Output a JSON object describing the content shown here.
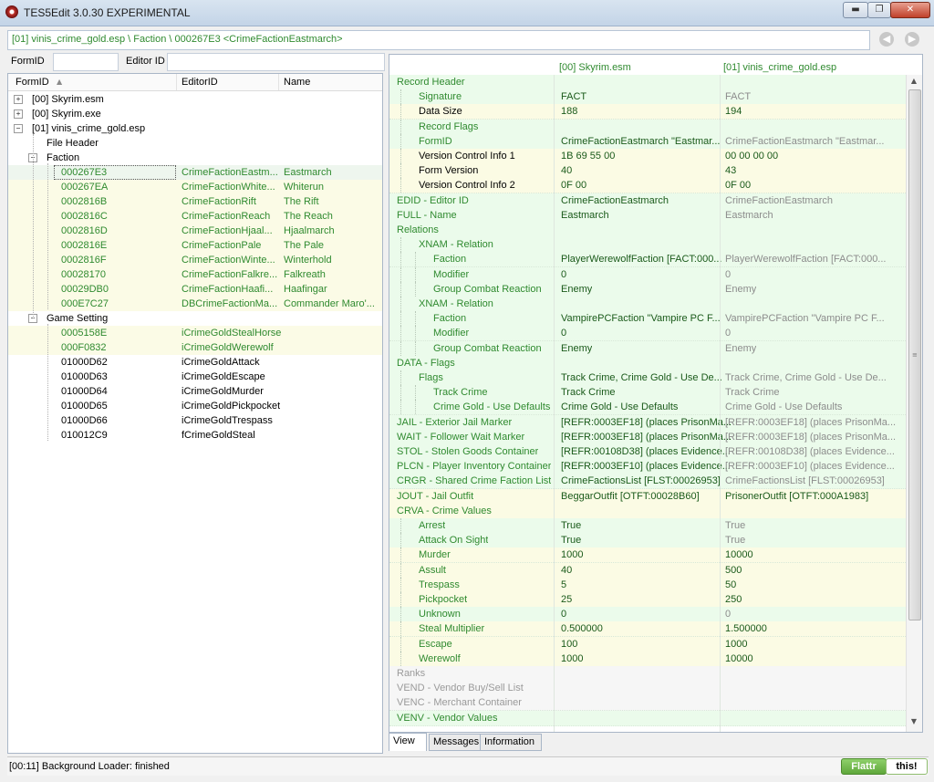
{
  "window": {
    "title": "TES5Edit 3.0.30 EXPERIMENTAL",
    "min_glyph": "▬",
    "max_glyph": "❐",
    "close_glyph": "✕"
  },
  "icons": {
    "back": "arrow-left-icon",
    "forward": "arrow-right-icon",
    "back_glyph": "◀",
    "forward_glyph": "▶",
    "sort_glyph": "▲",
    "expand_glyph": "+",
    "collapse_glyph": "−"
  },
  "path": "[01] vinis_crime_gold.esp \\ Faction \\ 000267E3 <CrimeFactionEastmarch>",
  "filter": {
    "formid_label": "FormID",
    "editorid_label": "Editor ID",
    "formid_value": "",
    "editorid_value": ""
  },
  "tree": {
    "columns": {
      "formid": "FormID",
      "editorid": "EditorID",
      "name": "Name"
    },
    "roots": [
      {
        "label": "[00] Skyrim.esm"
      },
      {
        "label": "[00] Skyrim.exe"
      },
      {
        "label": "[01] vinis_crime_gold.esp"
      }
    ],
    "file_header": "File Header",
    "faction_group": "Faction",
    "faction_rows": [
      {
        "formid": "000267E3",
        "editorid": "CrimeFactionEastm...",
        "name": "Eastmarch"
      },
      {
        "formid": "000267EA",
        "editorid": "CrimeFactionWhite...",
        "name": "Whiterun"
      },
      {
        "formid": "0002816B",
        "editorid": "CrimeFactionRift",
        "name": "The Rift"
      },
      {
        "formid": "0002816C",
        "editorid": "CrimeFactionReach",
        "name": "The Reach"
      },
      {
        "formid": "0002816D",
        "editorid": "CrimeFactionHjaal...",
        "name": "Hjaalmarch"
      },
      {
        "formid": "0002816E",
        "editorid": "CrimeFactionPale",
        "name": "The Pale"
      },
      {
        "formid": "0002816F",
        "editorid": "CrimeFactionWinte...",
        "name": "Winterhold"
      },
      {
        "formid": "00028170",
        "editorid": "CrimeFactionFalkre...",
        "name": "Falkreath"
      },
      {
        "formid": "00029DB0",
        "editorid": "CrimeFactionHaafi...",
        "name": "Haafingar"
      },
      {
        "formid": "000E7C27",
        "editorid": "DBCrimeFactionMa...",
        "name": "Commander Maro'..."
      }
    ],
    "gmst_group": "Game Setting",
    "gmst_rows": [
      {
        "formid": "0005158E",
        "editorid": "iCrimeGoldStealHorse",
        "name": ""
      },
      {
        "formid": "000F0832",
        "editorid": "iCrimeGoldWerewolf",
        "name": ""
      },
      {
        "formid": "01000D62",
        "editorid": "iCrimeGoldAttack",
        "name": ""
      },
      {
        "formid": "01000D63",
        "editorid": "iCrimeGoldEscape",
        "name": ""
      },
      {
        "formid": "01000D64",
        "editorid": "iCrimeGoldMurder",
        "name": ""
      },
      {
        "formid": "01000D65",
        "editorid": "iCrimeGoldPickpocket",
        "name": ""
      },
      {
        "formid": "01000D66",
        "editorid": "iCrimeGoldTrespass",
        "name": ""
      },
      {
        "formid": "010012C9",
        "editorid": "fCrimeGoldSteal",
        "name": ""
      }
    ]
  },
  "view": {
    "col1": "[00] Skyrim.esm",
    "col2": "[01] vinis_crime_gold.esp",
    "rows": [
      {
        "label": "Record Header",
        "indent": 0,
        "v1": "",
        "v2": "",
        "bg": "g",
        "lc": "lbl-green"
      },
      {
        "label": "Signature",
        "indent": 1,
        "v1": "FACT",
        "v2": "FACT",
        "bg": "g",
        "lc": "lbl-green"
      },
      {
        "label": "Data Size",
        "indent": 1,
        "v1": "188",
        "v2": "194",
        "bg": "y",
        "lc": ""
      },
      {
        "label": "Record Flags",
        "indent": 1,
        "v1": "",
        "v2": "",
        "bg": "g",
        "lc": "lbl-green"
      },
      {
        "label": "FormID",
        "indent": 1,
        "v1": "CrimeFactionEastmarch \"Eastmar...",
        "v2": "CrimeFactionEastmarch \"Eastmar...",
        "bg": "g",
        "lc": "lbl-green"
      },
      {
        "label": "Version Control Info 1",
        "indent": 1,
        "v1": "1B 69 55 00",
        "v2": "00 00 00 00",
        "bg": "y",
        "lc": ""
      },
      {
        "label": "Form Version",
        "indent": 1,
        "v1": "40",
        "v2": "43",
        "bg": "y",
        "lc": ""
      },
      {
        "label": "Version Control Info 2",
        "indent": 1,
        "v1": "0F 00",
        "v2": "0F 00",
        "bg": "y",
        "lc": ""
      },
      {
        "label": "EDID - Editor ID",
        "indent": 0,
        "v1": "CrimeFactionEastmarch",
        "v2": "CrimeFactionEastmarch",
        "bg": "g",
        "lc": "lbl-green"
      },
      {
        "label": "FULL - Name",
        "indent": 0,
        "v1": "Eastmarch",
        "v2": "Eastmarch",
        "bg": "g",
        "lc": "lbl-green"
      },
      {
        "label": "Relations",
        "indent": 0,
        "v1": "",
        "v2": "",
        "bg": "g",
        "lc": "lbl-green"
      },
      {
        "label": "XNAM - Relation",
        "indent": 1,
        "v1": "",
        "v2": "",
        "bg": "g",
        "lc": "lbl-green"
      },
      {
        "label": "Faction",
        "indent": 2,
        "v1": "PlayerWerewolfFaction [FACT:000...",
        "v2": "PlayerWerewolfFaction [FACT:000...",
        "bg": "g",
        "lc": "lbl-green"
      },
      {
        "label": "Modifier",
        "indent": 2,
        "v1": "0",
        "v2": "0",
        "bg": "g",
        "lc": "lbl-green"
      },
      {
        "label": "Group Combat Reaction",
        "indent": 2,
        "v1": "Enemy",
        "v2": "Enemy",
        "bg": "g",
        "lc": "lbl-green"
      },
      {
        "label": "XNAM - Relation",
        "indent": 1,
        "v1": "",
        "v2": "",
        "bg": "g",
        "lc": "lbl-green"
      },
      {
        "label": "Faction",
        "indent": 2,
        "v1": "VampirePCFaction \"Vampire PC F...",
        "v2": "VampirePCFaction \"Vampire PC F...",
        "bg": "g",
        "lc": "lbl-green"
      },
      {
        "label": "Modifier",
        "indent": 2,
        "v1": "0",
        "v2": "0",
        "bg": "g",
        "lc": "lbl-green"
      },
      {
        "label": "Group Combat Reaction",
        "indent": 2,
        "v1": "Enemy",
        "v2": "Enemy",
        "bg": "g",
        "lc": "lbl-green"
      },
      {
        "label": "DATA - Flags",
        "indent": 0,
        "v1": "",
        "v2": "",
        "bg": "g",
        "lc": "lbl-green"
      },
      {
        "label": "Flags",
        "indent": 1,
        "v1": "Track Crime, Crime Gold - Use De...",
        "v2": "Track Crime, Crime Gold - Use De...",
        "bg": "g",
        "lc": "lbl-green"
      },
      {
        "label": "Track Crime",
        "indent": 2,
        "v1": "Track Crime",
        "v2": "Track Crime",
        "bg": "g",
        "lc": "lbl-green"
      },
      {
        "label": "Crime Gold - Use Defaults",
        "indent": 2,
        "v1": "Crime Gold - Use Defaults",
        "v2": "Crime Gold - Use Defaults",
        "bg": "g",
        "lc": "lbl-green"
      },
      {
        "label": "JAIL - Exterior Jail Marker",
        "indent": 0,
        "v1": "[REFR:0003EF18] (places PrisonMa...",
        "v2": "[REFR:0003EF18] (places PrisonMa...",
        "bg": "g",
        "lc": "lbl-green"
      },
      {
        "label": "WAIT - Follower Wait Marker",
        "indent": 0,
        "v1": "[REFR:0003EF18] (places PrisonMa...",
        "v2": "[REFR:0003EF18] (places PrisonMa...",
        "bg": "g",
        "lc": "lbl-green"
      },
      {
        "label": "STOL - Stolen Goods Container",
        "indent": 0,
        "v1": "[REFR:00108D38] (places Evidence...",
        "v2": "[REFR:00108D38] (places Evidence...",
        "bg": "g",
        "lc": "lbl-green"
      },
      {
        "label": "PLCN - Player Inventory Container",
        "indent": 0,
        "v1": "[REFR:0003EF10] (places Evidence...",
        "v2": "[REFR:0003EF10] (places Evidence...",
        "bg": "g",
        "lc": "lbl-green"
      },
      {
        "label": "CRGR - Shared Crime Faction List",
        "indent": 0,
        "v1": "CrimeFactionsList [FLST:00026953]",
        "v2": "CrimeFactionsList [FLST:00026953]",
        "bg": "g",
        "lc": "lbl-green"
      },
      {
        "label": "JOUT - Jail Outfit",
        "indent": 0,
        "v1": "BeggarOutfit [OTFT:00028B60]",
        "v2": "PrisonerOutfit [OTFT:000A1983]",
        "bg": "y",
        "lc": "lbl-green"
      },
      {
        "label": "CRVA - Crime Values",
        "indent": 0,
        "v1": "",
        "v2": "",
        "bg": "y",
        "lc": "lbl-green"
      },
      {
        "label": "Arrest",
        "indent": 1,
        "v1": "True",
        "v2": "True",
        "bg": "g",
        "lc": "lbl-green"
      },
      {
        "label": "Attack On Sight",
        "indent": 1,
        "v1": "True",
        "v2": "True",
        "bg": "g",
        "lc": "lbl-green"
      },
      {
        "label": "Murder",
        "indent": 1,
        "v1": "1000",
        "v2": "10000",
        "bg": "y",
        "lc": "lbl-green"
      },
      {
        "label": "Assult",
        "indent": 1,
        "v1": "40",
        "v2": "500",
        "bg": "y",
        "lc": "lbl-green"
      },
      {
        "label": "Trespass",
        "indent": 1,
        "v1": "5",
        "v2": "50",
        "bg": "y",
        "lc": "lbl-green"
      },
      {
        "label": "Pickpocket",
        "indent": 1,
        "v1": "25",
        "v2": "250",
        "bg": "y",
        "lc": "lbl-green"
      },
      {
        "label": "Unknown",
        "indent": 1,
        "v1": "0",
        "v2": "0",
        "bg": "g",
        "lc": "lbl-green"
      },
      {
        "label": "Steal Multiplier",
        "indent": 1,
        "v1": "0.500000",
        "v2": "1.500000",
        "bg": "y",
        "lc": "lbl-green"
      },
      {
        "label": "Escape",
        "indent": 1,
        "v1": "100",
        "v2": "1000",
        "bg": "y",
        "lc": "lbl-green"
      },
      {
        "label": "Werewolf",
        "indent": 1,
        "v1": "1000",
        "v2": "10000",
        "bg": "y",
        "lc": "lbl-green"
      },
      {
        "label": "Ranks",
        "indent": 0,
        "v1": "",
        "v2": "",
        "bg": "gr",
        "lc": "lbl-gray"
      },
      {
        "label": "VEND - Vendor Buy/Sell List",
        "indent": 0,
        "v1": "",
        "v2": "",
        "bg": "gr",
        "lc": "lbl-gray"
      },
      {
        "label": "VENC - Merchant Container",
        "indent": 0,
        "v1": "",
        "v2": "",
        "bg": "gr",
        "lc": "lbl-gray"
      },
      {
        "label": "VENV - Vendor Values",
        "indent": 0,
        "v1": "",
        "v2": "",
        "bg": "g",
        "lc": "lbl-green"
      }
    ]
  },
  "scrollbar": {
    "up_glyph": "▲",
    "down_glyph": "▼",
    "grip_glyph": "≡"
  },
  "tabs": {
    "view": "View",
    "messages": "Messages",
    "information": "Information"
  },
  "status": {
    "text": "[00:11] Background Loader: finished",
    "flattr": "Flattr",
    "this": "this!"
  },
  "colors": {
    "title_gradient_top": "#d8e4f0",
    "green_text": "#2f8a2f",
    "row_green": "#ebfbeb",
    "row_yellow": "#fbfbe4"
  }
}
